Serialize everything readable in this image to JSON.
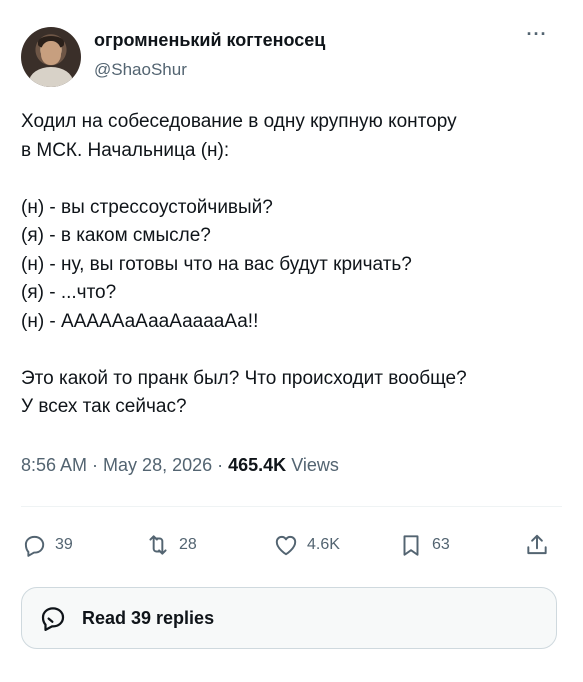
{
  "author": {
    "display_name": "огромненький когтеносец",
    "handle": "@ShaoShur"
  },
  "more_menu": "···",
  "tweet_lines": {
    "intro_1": "Ходил на собеседование в одну крупную контору",
    "intro_2": "в МСК. Начальница (н):",
    "dialog_1": "(н) - вы стрессоустойчивый?",
    "dialog_2": "(я) - в каком смысле?",
    "dialog_3": "(н) - ну, вы готовы что на вас будут кричать?",
    "dialog_4": "(я) - ...что?",
    "dialog_5": "(н) - АААААаАааАааааАа!!",
    "outro_1": "Это какой то пранк был? Что происходит вообще?",
    "outro_2": "У всех так сейчас?"
  },
  "meta": {
    "time": "8:56 AM",
    "separator": " · ",
    "date": "May 28, 2026",
    "views_count": "465.4K",
    "views_label": "Views"
  },
  "actions": {
    "reply": {
      "icon": "reply-icon",
      "count": "39"
    },
    "retweet": {
      "icon": "retweet-icon",
      "count": "28"
    },
    "like": {
      "icon": "heart-icon",
      "count": "4.6K"
    },
    "bookmark": {
      "icon": "bookmark-icon",
      "count": "63"
    },
    "share": {
      "icon": "share-icon"
    }
  },
  "replies_button": {
    "icon": "reply-bubble-icon",
    "label": "Read 39 replies"
  },
  "colors": {
    "text": "#0f1419",
    "secondary": "#536471",
    "border": "#cfd9de",
    "divider": "#eff3f4",
    "button_bg": "#f7f9f9"
  }
}
